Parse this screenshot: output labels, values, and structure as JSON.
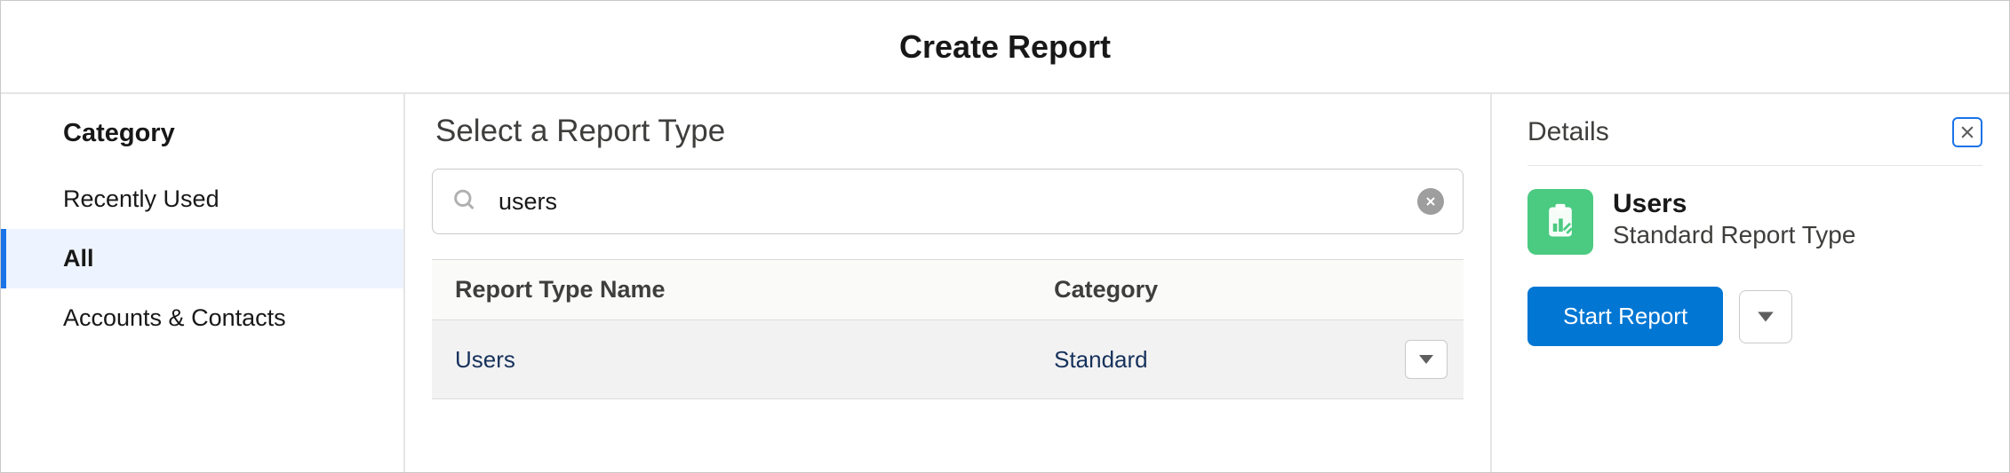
{
  "header": {
    "title": "Create Report"
  },
  "sidebar": {
    "heading": "Category",
    "items": [
      {
        "label": "Recently Used",
        "active": false
      },
      {
        "label": "All",
        "active": true
      },
      {
        "label": "Accounts & Contacts",
        "active": false
      }
    ]
  },
  "main": {
    "title": "Select a Report Type",
    "search_value": "users",
    "columns": {
      "name": "Report Type Name",
      "category": "Category"
    },
    "rows": [
      {
        "name": "Users",
        "category": "Standard"
      }
    ]
  },
  "details": {
    "title": "Details",
    "selected_name": "Users",
    "selected_subtitle": "Standard Report Type",
    "start_label": "Start Report"
  }
}
